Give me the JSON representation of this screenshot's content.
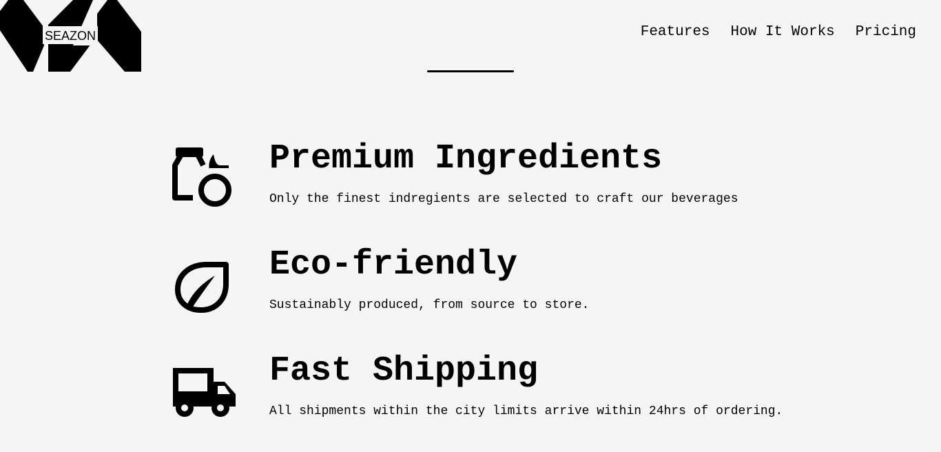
{
  "header": {
    "logo_text": "SEAZON",
    "nav": [
      {
        "label": "Features"
      },
      {
        "label": "How It Works"
      },
      {
        "label": "Pricing"
      }
    ]
  },
  "features": [
    {
      "title": "Premium Ingredients",
      "description": "Only the finest indregients are selected to craft our beverages",
      "icon": "bottle-fruit-icon"
    },
    {
      "title": "Eco-friendly",
      "description": "Sustainably produced, from source to store.",
      "icon": "leaf-icon"
    },
    {
      "title": "Fast Shipping",
      "description": "All shipments within the city limits arrive within 24hrs of ordering.",
      "icon": "truck-icon"
    }
  ]
}
